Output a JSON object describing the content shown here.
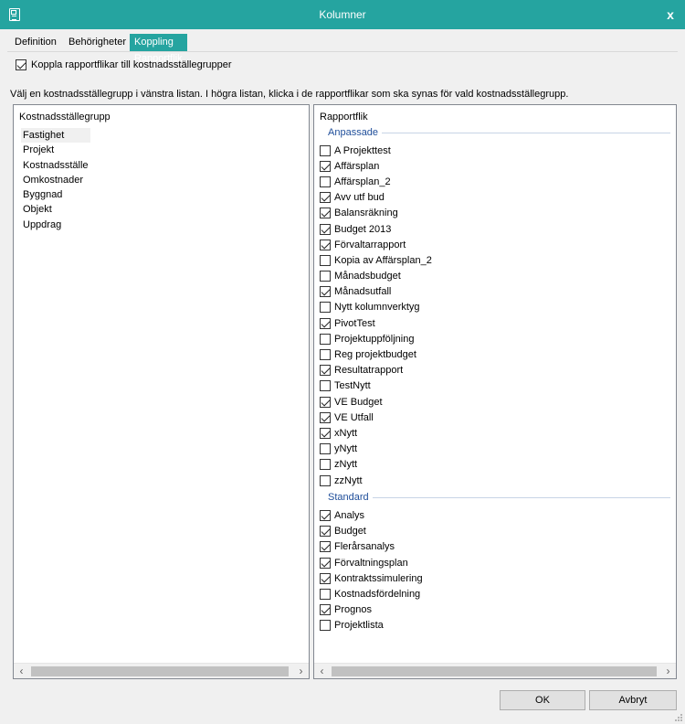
{
  "window": {
    "title": "Kolumner",
    "icon": "document-icon",
    "close_glyph": "x",
    "accent": "#25a4a0"
  },
  "tabs": [
    {
      "label": "Definition",
      "active": false
    },
    {
      "label": "Behörigheter",
      "active": false
    },
    {
      "label": "Koppling Rapportflik",
      "active": true
    }
  ],
  "link_checkbox": {
    "label": "Koppla rapportflikar till kostnadsställegrupper",
    "checked": true
  },
  "instruction": "Välj en kostnadsställegrupp i vänstra listan. I högra listan, klicka i de rapportflikar som ska synas för vald kostnadsställegrupp.",
  "left_panel": {
    "header": "Kostnadsställegrupp",
    "items": [
      "Fastighet",
      "Projekt",
      "Kostnadsställe",
      "Omkostnader",
      "Byggnad",
      "Objekt",
      "Uppdrag"
    ],
    "selected_index": 0
  },
  "right_panel": {
    "header": "Rapportflik",
    "groups": [
      {
        "name": "Anpassade",
        "items": [
          {
            "label": "A Projekttest",
            "checked": false
          },
          {
            "label": "Affärsplan",
            "checked": true
          },
          {
            "label": "Affärsplan_2",
            "checked": false
          },
          {
            "label": "Avv utf bud",
            "checked": true
          },
          {
            "label": "Balansräkning",
            "checked": true
          },
          {
            "label": "Budget 2013",
            "checked": true
          },
          {
            "label": "Förvaltarrapport",
            "checked": true
          },
          {
            "label": "Kopia av Affärsplan_2",
            "checked": false
          },
          {
            "label": "Månadsbudget",
            "checked": false
          },
          {
            "label": "Månadsutfall",
            "checked": true
          },
          {
            "label": "Nytt kolumnverktyg",
            "checked": false
          },
          {
            "label": "PivotTest",
            "checked": true
          },
          {
            "label": "Projektuppföljning",
            "checked": false
          },
          {
            "label": "Reg projektbudget",
            "checked": false
          },
          {
            "label": "Resultatrapport",
            "checked": true
          },
          {
            "label": "TestNytt",
            "checked": false
          },
          {
            "label": "VE Budget",
            "checked": true
          },
          {
            "label": "VE Utfall",
            "checked": true
          },
          {
            "label": "xNytt",
            "checked": true
          },
          {
            "label": "yNytt",
            "checked": false
          },
          {
            "label": "zNytt",
            "checked": false
          },
          {
            "label": "zzNytt",
            "checked": false
          }
        ]
      },
      {
        "name": "Standard",
        "items": [
          {
            "label": "Analys",
            "checked": true
          },
          {
            "label": "Budget",
            "checked": true
          },
          {
            "label": "Flerårsanalys",
            "checked": true
          },
          {
            "label": "Förvaltningsplan",
            "checked": true
          },
          {
            "label": "Kontraktssimulering",
            "checked": true
          },
          {
            "label": "Kostnadsfördelning",
            "checked": false
          },
          {
            "label": "Prognos",
            "checked": true
          },
          {
            "label": "Projektlista",
            "checked": false
          }
        ]
      }
    ]
  },
  "scrollbars": {
    "left_arrow": "‹",
    "right_arrow": "›"
  },
  "buttons": {
    "ok": "OK",
    "cancel": "Avbryt"
  }
}
